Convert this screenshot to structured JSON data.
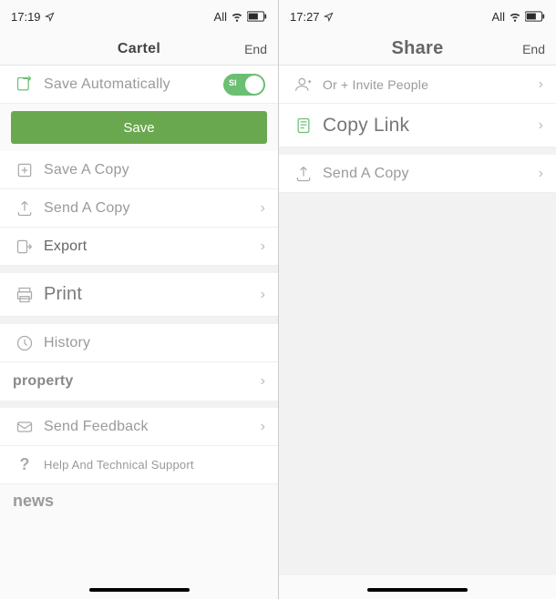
{
  "left": {
    "status": {
      "time": "17:19",
      "carrier": "All"
    },
    "nav": {
      "title": "Cartel",
      "end": "End"
    },
    "auto_save": {
      "label": "Save Automatically"
    },
    "save_btn": "Save",
    "save_copy": "Save A Copy",
    "send_copy": "Send A Copy",
    "export": "Export",
    "print": "Print",
    "history": "History",
    "property": "property",
    "feedback": "Send Feedback",
    "help": "Help And Technical Support",
    "news": "news"
  },
  "right": {
    "status": {
      "time": "17:27",
      "carrier": "All"
    },
    "nav": {
      "title": "Share",
      "end": "End"
    },
    "invite": "Or + Invite People",
    "copy_link": "Copy Link",
    "send_copy": "Send A Copy"
  }
}
